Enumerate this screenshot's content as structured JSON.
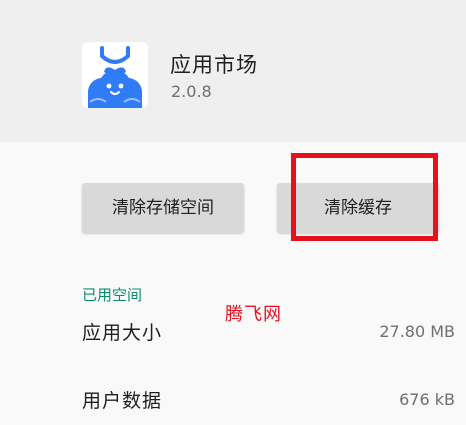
{
  "app": {
    "name": "应用市场",
    "version": "2.0.8",
    "icon": "app-market-shopping-bag-icon",
    "brand_color": "#2f7cf6"
  },
  "buttons": {
    "clear_storage": "清除存储空间",
    "clear_cache": "清除缓存"
  },
  "storage": {
    "section_title": "已用空间",
    "rows": [
      {
        "label": "应用大小",
        "value": "27.80 MB"
      },
      {
        "label": "用户数据",
        "value": "676 kB"
      }
    ]
  },
  "watermark": "腾飞网",
  "colors": {
    "accent_green": "#0e8a6d",
    "highlight_red": "#e3121b",
    "button_gray": "#d9d9d9"
  }
}
